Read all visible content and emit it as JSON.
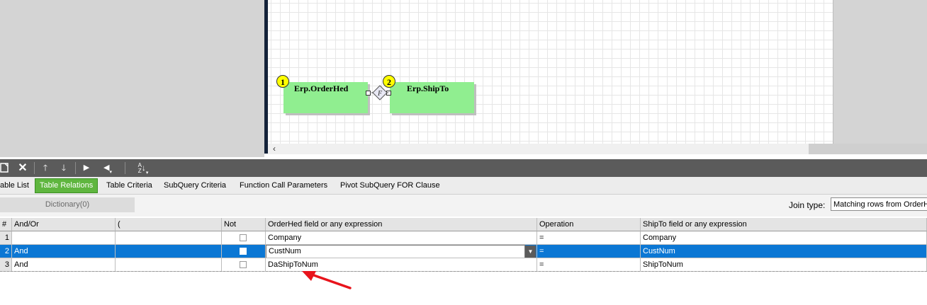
{
  "diagram": {
    "tables": [
      {
        "number": "1",
        "name": "Erp.OrderHed"
      },
      {
        "number": "2",
        "name": "Erp.ShipTo"
      }
    ],
    "join_symbol": "F"
  },
  "toolbar": {
    "icons": [
      "new-icon",
      "delete-icon",
      "move-up-icon",
      "move-down-icon",
      "play-icon",
      "step-back-icon",
      "sort-az-icon"
    ]
  },
  "tabs": [
    {
      "label": "able List",
      "active": false
    },
    {
      "label": "Table Relations",
      "active": true
    },
    {
      "label": "Table Criteria",
      "active": false
    },
    {
      "label": "SubQuery Criteria",
      "active": false
    },
    {
      "label": "Function Call Parameters",
      "active": false
    },
    {
      "label": "Pivot SubQuery FOR Clause",
      "active": false
    }
  ],
  "filter": {
    "dictionary_button": "Dictionary(0)",
    "join_type_label": "Join type:",
    "join_type_value": "Matching rows from OrderH"
  },
  "grid": {
    "headers": [
      "#",
      "And/Or",
      "(",
      "Not",
      "OrderHed field or any expression",
      "Operation",
      "ShipTo field or any expression"
    ],
    "rows": [
      {
        "num": "1",
        "andor": "",
        "paren": "",
        "not": false,
        "left": "Company",
        "op": "=",
        "right": "Company",
        "selected": false
      },
      {
        "num": "2",
        "andor": "And",
        "paren": "",
        "not": false,
        "left": "CustNum",
        "op": "=",
        "right": "CustNum",
        "selected": true
      },
      {
        "num": "3",
        "andor": "And",
        "paren": "",
        "not": false,
        "left": "DaShipToNum",
        "op": "=",
        "right": "ShipToNum",
        "selected": false
      }
    ]
  },
  "colors": {
    "accent_tab": "#5fb63f",
    "selection": "#0b77d4",
    "table_node": "#90ee90",
    "annotation_arrow": "#e8141c"
  }
}
